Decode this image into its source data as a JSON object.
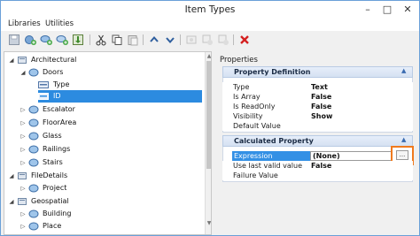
{
  "window": {
    "title": "Item Types",
    "controls": {
      "minimize": "–",
      "maximize": "□",
      "close": "✕"
    }
  },
  "menu": [
    "Libraries",
    "Utilities"
  ],
  "toolbar": {
    "buttons": [
      "save-icon",
      "add-library-icon",
      "add-item-type-icon",
      "add-property-icon",
      "import-icon",
      "cut-icon",
      "copy-icon",
      "paste-icon",
      "move-up-icon",
      "move-down-icon",
      "disabled-icon-1",
      "disabled-icon-2",
      "disabled-icon-3",
      "delete-icon"
    ]
  },
  "tree": {
    "nodes": [
      {
        "label": "Architectural",
        "level": 0,
        "expand": "◢",
        "icon": "library-icon"
      },
      {
        "label": "Doors",
        "level": 1,
        "expand": "◢",
        "icon": "item-type-icon"
      },
      {
        "label": "Type",
        "level": 2,
        "expand": "",
        "icon": "property-icon"
      },
      {
        "label": "ID",
        "level": 2,
        "expand": "",
        "icon": "property-icon",
        "selected": true
      },
      {
        "label": "Escalator",
        "level": 1,
        "expand": "▷",
        "icon": "item-type-icon"
      },
      {
        "label": "FloorArea",
        "level": 1,
        "expand": "▷",
        "icon": "item-type-icon"
      },
      {
        "label": "Glass",
        "level": 1,
        "expand": "▷",
        "icon": "item-type-icon"
      },
      {
        "label": "Railings",
        "level": 1,
        "expand": "▷",
        "icon": "item-type-icon"
      },
      {
        "label": "Stairs",
        "level": 1,
        "expand": "▷",
        "icon": "item-type-icon"
      },
      {
        "label": "FileDetails",
        "level": 0,
        "expand": "◢",
        "icon": "library-icon"
      },
      {
        "label": "Project",
        "level": 1,
        "expand": "▷",
        "icon": "item-type-icon"
      },
      {
        "label": "Geospatial",
        "level": 0,
        "expand": "◢",
        "icon": "library-icon"
      },
      {
        "label": "Building",
        "level": 1,
        "expand": "▷",
        "icon": "item-type-icon"
      },
      {
        "label": "Place",
        "level": 1,
        "expand": "▷",
        "icon": "item-type-icon"
      }
    ]
  },
  "properties": {
    "header": "Properties",
    "definition": {
      "title": "Property Definition",
      "rows": [
        {
          "name": "Type",
          "value": "Text"
        },
        {
          "name": "Is Array",
          "value": "False"
        },
        {
          "name": "Is ReadOnly",
          "value": "False"
        },
        {
          "name": "Visibility",
          "value": "Show"
        },
        {
          "name": "Default Value",
          "value": ""
        }
      ]
    },
    "calculated": {
      "title": "Calculated Property",
      "expression": {
        "name": "Expression",
        "value": "(None)",
        "button": "..."
      },
      "rows": [
        {
          "name": "Use last valid value",
          "value": "False"
        },
        {
          "name": "Failure Value",
          "value": ""
        }
      ]
    }
  },
  "colors": {
    "selection": "#2c8be0",
    "highlight": "#f07a1e",
    "section": "#d5e1f2"
  }
}
